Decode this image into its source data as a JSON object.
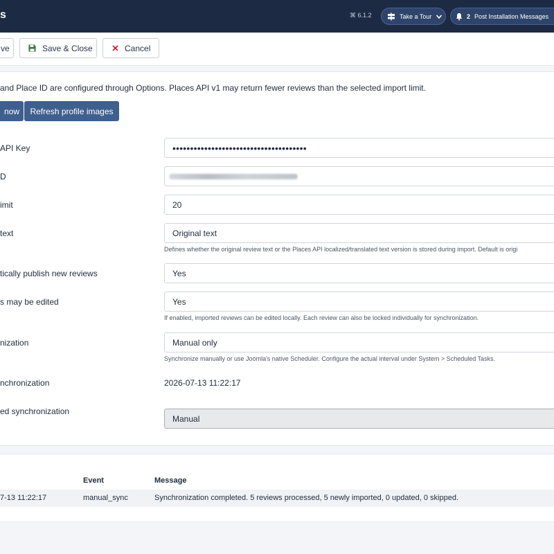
{
  "header": {
    "title": "s",
    "version": "⌘ 6.1.2",
    "tour_label": "Take a Tour",
    "messages_count": "2",
    "messages_label": "Post Installation Messages"
  },
  "toolbar": {
    "save_label": "ve",
    "save_close_label": "Save & Close",
    "cancel_label": "Cancel"
  },
  "main": {
    "notice": "and Place ID are configured through Options. Places API v1 may return fewer reviews than the selected import limit.",
    "import_button": "now",
    "refresh_button": "Refresh profile images",
    "fields": {
      "api_key": {
        "label": "API Key",
        "value": "••••••••••••••••••••••••••••••••••••••"
      },
      "place_id": {
        "label": "D"
      },
      "import_limit": {
        "label": "imit",
        "value": "20"
      },
      "review_text": {
        "label": "text",
        "value": "Original text",
        "help": "Defines whether the original review text or the Places API localized/translated text version is stored during import. Default is origi"
      },
      "auto_publish": {
        "label": "tically publish new reviews",
        "value": "Yes"
      },
      "edit_reviews": {
        "label": "s may be edited",
        "value": "Yes",
        "help": "If enabled, imported reviews can be edited locally. Each review can also be locked individually for synchronization."
      },
      "synchronization": {
        "label": "nization",
        "value": "Manual only",
        "help": "Synchronize manually or use Joomla's native Scheduler. Configure the actual interval under System > Scheduled Tasks."
      },
      "last_sync": {
        "label": "nchronization",
        "value": "2026-07-13 11:22:17"
      },
      "last_sync_type": {
        "label": "ed synchronization",
        "value": "Manual"
      }
    }
  },
  "log": {
    "title": "",
    "headers": {
      "date": "",
      "event": "Event",
      "message": "Message"
    },
    "rows": [
      {
        "date": "7-13 11:22:17",
        "event": "manual_sync",
        "message": "Synchronization completed. 5 reviews processed, 5 newly imported, 0 updated, 0 skipped."
      }
    ]
  },
  "colors": {
    "header_bg": "#1d2a44",
    "primary_button": "#3f5f8e",
    "page_bg": "#f3f5f9"
  }
}
